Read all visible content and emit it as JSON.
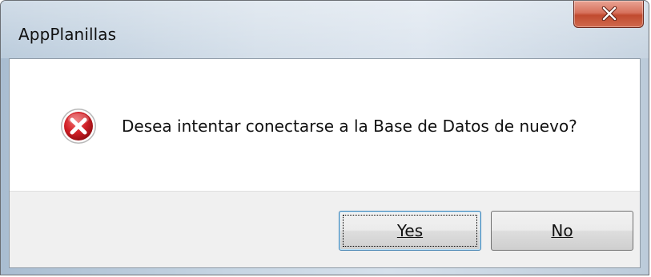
{
  "window": {
    "title": "AppPlanillas"
  },
  "dialog": {
    "icon": "error-icon",
    "message": "Desea intentar conectarse a la Base de Datos de nuevo?"
  },
  "buttons": {
    "yes_label": "Yes",
    "no_label": "No",
    "default": "yes"
  },
  "colors": {
    "close_button": "#c14a2f",
    "error_icon": "#c4161c",
    "footer_bg": "#f0f0f0"
  }
}
